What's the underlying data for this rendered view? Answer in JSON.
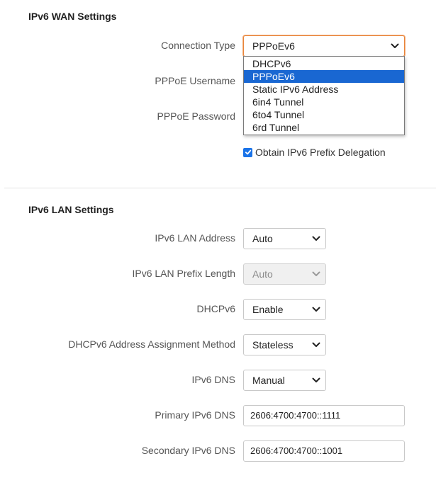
{
  "wan": {
    "title": "IPv6 WAN Settings",
    "connection_type": {
      "label": "Connection Type",
      "value": "PPPoEv6",
      "options": [
        "DHCPv6",
        "PPPoEv6",
        "Static IPv6 Address",
        "6in4 Tunnel",
        "6to4 Tunnel",
        "6rd Tunnel"
      ]
    },
    "pppoe_username": {
      "label": "PPPoE Username"
    },
    "pppoe_password": {
      "label": "PPPoE Password"
    },
    "prefix_delegation": {
      "label": "Obtain IPv6 Prefix Delegation",
      "checked": true
    }
  },
  "lan": {
    "title": "IPv6 LAN Settings",
    "lan_address": {
      "label": "IPv6 LAN Address",
      "value": "Auto"
    },
    "prefix_length": {
      "label": "IPv6 LAN Prefix Length",
      "value": "Auto",
      "disabled": true
    },
    "dhcpv6": {
      "label": "DHCPv6",
      "value": "Enable"
    },
    "assignment_method": {
      "label": "DHCPv6 Address Assignment Method",
      "value": "Stateless"
    },
    "dns": {
      "label": "IPv6 DNS",
      "value": "Manual"
    },
    "primary_dns": {
      "label": "Primary IPv6 DNS",
      "value": "2606:4700:4700::1111"
    },
    "secondary_dns": {
      "label": "Secondary IPv6 DNS",
      "value": "2606:4700:4700::1001"
    }
  },
  "colors": {
    "accent": "#1967d2",
    "focus_border": "#e8843a",
    "checkbox": "#1a73e8"
  },
  "icons": {
    "select_arrow": "chevron-down-icon",
    "checkbox_check": "check-icon"
  }
}
